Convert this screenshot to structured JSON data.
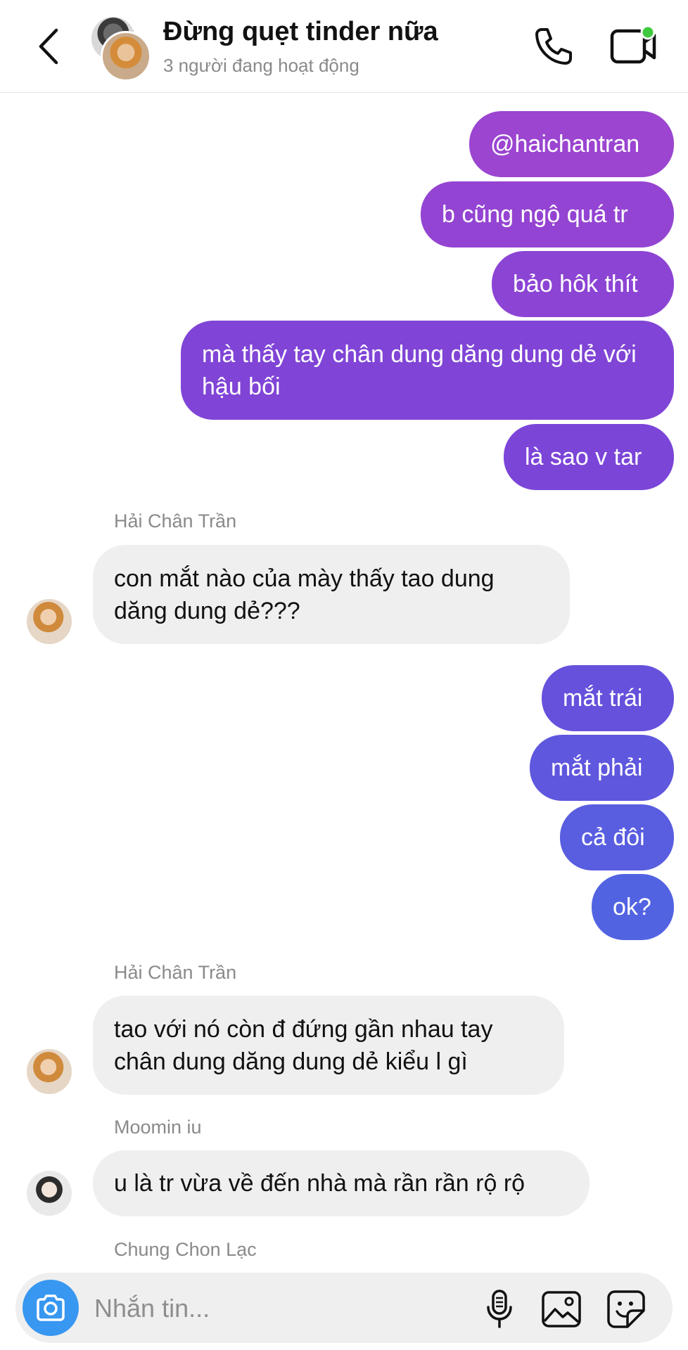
{
  "header": {
    "title": "Đừng quẹt tinder nữa",
    "subtitle": "3 người đang hoạt động",
    "back_icon": "chevron-left-icon",
    "call_icon": "phone-icon",
    "video_icon": "video-camera-icon",
    "active_dot_color": "#3ec93e"
  },
  "messages": [
    {
      "direction": "out",
      "text": "@haichantran",
      "color": "#9b45d0"
    },
    {
      "direction": "out",
      "text": "b cũng ngộ quá tr",
      "color": "#9444d2"
    },
    {
      "direction": "out",
      "text": "bảo hôk thít",
      "color": "#8c44d4"
    },
    {
      "direction": "out",
      "text": "mà thấy tay chân dung dăng dung dẻ với hậu bối",
      "color": "#8044d6"
    },
    {
      "direction": "out",
      "text": "là sao v tar",
      "color": "#7b45d8"
    },
    {
      "direction": "in",
      "sender": "Hải Chân Trần",
      "text": "con mắt nào của mày thấy tao dung dăng dung dẻ???"
    },
    {
      "direction": "out",
      "text": "mắt trái",
      "color": "#6551dc"
    },
    {
      "direction": "out",
      "text": "mắt phải",
      "color": "#5f57de"
    },
    {
      "direction": "out",
      "text": "cả đôi",
      "color": "#595de0"
    },
    {
      "direction": "out",
      "text": "ok?",
      "color": "#5263e2"
    },
    {
      "direction": "in",
      "sender": "Hải Chân Trần",
      "text": "tao với nó còn đ đứng gần nhau tay chân dung dăng dung dẻ kiểu l gì"
    },
    {
      "direction": "in",
      "sender": "Moomin iu",
      "text": "u là tr vừa về đến nhà mà rần rần rộ rộ"
    }
  ],
  "typing_sender": "Chung Chon Lạc",
  "composer": {
    "placeholder": "Nhắn tin...",
    "value": "",
    "camera_icon": "camera-icon",
    "mic_icon": "microphone-icon",
    "gallery_icon": "image-icon",
    "sticker_icon": "sticker-icon",
    "accent_color": "#3897f0"
  }
}
